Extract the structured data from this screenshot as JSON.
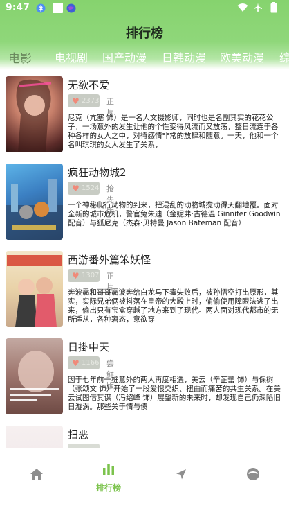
{
  "status_bar": {
    "time": "9:47",
    "icons": [
      "bluetooth-icon",
      "square-icon",
      "globe-icon",
      "wifi-icon",
      "airplane-icon",
      "battery-icon"
    ]
  },
  "header": {
    "title": "排行榜"
  },
  "tabs": [
    "电影",
    "电视剧",
    "国产动漫",
    "日韩动漫",
    "欧美动漫",
    "综"
  ],
  "active_tab": "电影",
  "movies": [
    {
      "title": "无欲不爱",
      "score": "2373",
      "tag": "正片",
      "description": "尼克（亢塞 饰）是一名人文摄影师，同时也是名副其实的花花公子，一场意外的发生让他的个性变得风流而又放荡，整日流连于各种各样的女人之中，对待感情非常的放肆和随意。一天，他和一个名叫琪琪的女人发生了关系，"
    },
    {
      "title": "疯狂动物城2",
      "score": "1524",
      "tag": "抢先版",
      "description": "一个神秘爬行动物的到来，把混乱的动物城搅动得天翻地覆。面对全新的城市危机，警官兔朱迪（金妮弗·古德温 Ginnifer Goodwin 配音）与狐尼克（杰森·贝特曼 Jason Bateman 配音）"
    },
    {
      "title": "西游番外篇笨妖怪",
      "score": "1307",
      "tag": "正片",
      "description": "奔波霸和哥哥霸波奔给白龙马下毒失败后，被孙悟空打出原形，其实，实际兄弟俩被抖落在皇帝的大殿上时，偷偷使用障眼法逃了出来，偷出只有宝盒穿越了地方来到了现代。两人面对现代都市的无所适从，各种窘态，意欲穿"
    },
    {
      "title": "日掛中天",
      "score": "1166",
      "tag": "尝鲜版",
      "description": "因于七年前一桩意外的两人再度相遇，美云（辛芷蕾 饰）与保树（张颂文 饰）开始了一段爱恨交织、扭曲而痛苦的共生关系。在美云试图借其谋（冯绍峰 饰）展望新的未来时，却发现自己仍深陷旧日漩涡。那些关于情与债"
    },
    {
      "title": "扫恶",
      "score": "",
      "tag": "",
      "description": ""
    }
  ],
  "bottom_nav": {
    "items": [
      {
        "icon": "home-icon",
        "label": ""
      },
      {
        "icon": "ranking-icon",
        "label": "排行榜"
      },
      {
        "icon": "navigation-icon",
        "label": ""
      },
      {
        "icon": "profile-icon",
        "label": ""
      }
    ],
    "active_index": 1
  },
  "colors": {
    "accent": "#7cc34d",
    "header": "#86d36e",
    "badge": "#c8ccc4"
  }
}
